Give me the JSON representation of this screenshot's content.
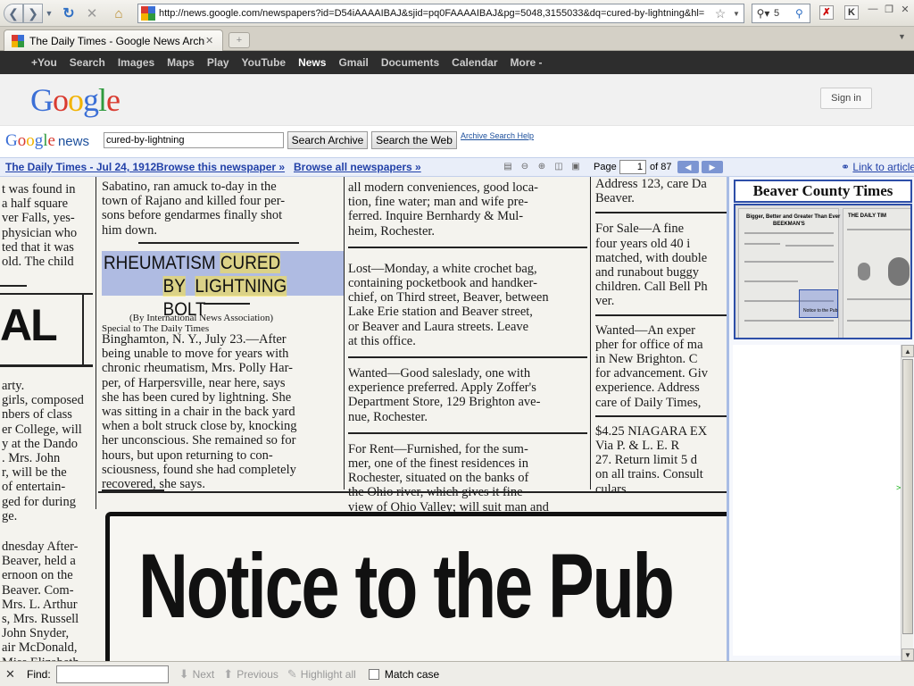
{
  "browser": {
    "url": "http://news.google.com/newspapers?id=D54iAAAAIBAJ&sjid=pq0FAAAAIBAJ&pg=5048,3155033&dq=cured-by-lightning&hl=",
    "search_value": "5",
    "tab_title": "The Daily Times - Google News Archi...",
    "icons": {
      "back": "back-arrow-icon",
      "forward": "forward-arrow-icon",
      "reload": "reload-icon",
      "stop": "stop-icon",
      "home": "home-icon",
      "bookmark": "star-icon",
      "search_engine": "magnifier-icon"
    }
  },
  "gbar": {
    "items": [
      "+You",
      "Search",
      "Images",
      "Maps",
      "Play",
      "YouTube",
      "News",
      "Gmail",
      "Documents",
      "Calendar",
      "More -"
    ],
    "active": "News"
  },
  "header": {
    "logo": "Google",
    "logo_colors": [
      "#3b6fd6",
      "#d93b30",
      "#f2b300",
      "#3b6fd6",
      "#2f9a3e",
      "#d93b30"
    ],
    "sign_in": "Sign in"
  },
  "search_row": {
    "logo": "Google",
    "logo_suffix": "news",
    "query": "cured-by-lightning",
    "search_archive": "Search Archive",
    "search_web": "Search the Web",
    "help": "Archive Search Help"
  },
  "info_bar": {
    "paper": "The Daily Times - Jul 24, 1912",
    "browse_this": "Browse this newspaper »",
    "browse_all": "Browse all newspapers »",
    "page_label": "Page",
    "page": "1",
    "page_total": "of 87",
    "link_article": "Link to article"
  },
  "article": {
    "headline_1": "RHEUMATISM CURED",
    "headline_2": "BY LIGHTNING BOLT",
    "byline_1": "(By International News Association)",
    "byline_2": "Special to The Daily Times",
    "col2_top": [
      "Sabatino, ran amuck to-day in the",
      "town of Rajano and killed four per-",
      "sons before gendarmes finally shot",
      "him down."
    ],
    "col2_body": [
      "Binghamton, N. Y., July 23.—After",
      "being unable to move for years with",
      "chronic rheumatism, Mrs. Polly Har-",
      "per, of Harpersville, near here, says",
      "she has been cured by lightning. She",
      "was sitting in a chair in the back yard",
      "when a bolt struck close by, knocking",
      "her unconscious. She remained so for",
      "hours, but upon returning to con-",
      "sciousness, found she had completely",
      "recovered, she says."
    ],
    "col1_top": [
      "t was found in",
      " a half square",
      "ver Falls, yes-",
      "physician who",
      "ted that it was",
      "old. The child"
    ],
    "col1_big": "AL",
    "col1_mid": [
      "arty.",
      "girls, composed",
      "nbers of class",
      "er College, will",
      "y at the Dando",
      ". Mrs. John",
      "r, will be the",
      "of entertain-",
      "ged for during",
      "ge."
    ],
    "col1_bottom": [
      "dnesday After-",
      "Beaver, held a",
      "ernoon on the",
      " Beaver. Com-",
      "Mrs. L. Arthur",
      "s, Mrs. Russell",
      " John Snyder,",
      "air McDonald,",
      "Miss Elizabeth"
    ],
    "col3_a": [
      "all modern conveniences, good loca-",
      "tion, fine water; man and wife pre-",
      "ferred. Inquire Bernhardy & Mul-",
      "heim, Rochester."
    ],
    "col3_b": [
      "Lost—Monday, a white crochet bag,",
      "containing pocketbook and handker-",
      "chief, on Third street, Beaver, between",
      "Lake Erie station and Beaver street,",
      "or Beaver and Laura streets. Leave",
      "at this office."
    ],
    "col3_c": [
      "Wanted—Good saleslady, one with",
      "experience preferred. Apply Zoffer's",
      "Department Store, 129 Brighton ave-",
      "nue, Rochester."
    ],
    "col3_d": [
      "For Rent—Furnished, for the sum-",
      "mer, one of the finest residences in",
      "Rochester, situated on the banks of",
      "the Ohio river, which gives it fine",
      "view of Ohio Valley; will suit man and"
    ],
    "col4_a": [
      "Address 123, care Da",
      "Beaver."
    ],
    "col4_b": [
      "For Sale—A fine",
      "four years old 40 i",
      "matched, with double",
      "and runabout buggy",
      "children. Call Bell Ph",
      "ver."
    ],
    "col4_c": [
      "Wanted—An exper",
      "pher for office of ma",
      "in New Brighton. C",
      "for advancement. Giv",
      "experience. Address",
      "care of Daily Times,"
    ],
    "col4_d": [
      "$4.25 NIAGARA EX",
      "Via P. & L. E. R",
      "27. Return limit 5 d",
      "on all trains. Consult",
      "culars."
    ],
    "ad_headline": "Notice to the Pub"
  },
  "sidebar": {
    "masthead": "Beaver County Times",
    "thumb_a_head": "Bigger, Better and Greater Than Ever",
    "thumb_a_sub": "BEEKMAN'S",
    "thumb_b_head": "THE DAILY TIM",
    "thumb_notice": "Notice to the Pub"
  },
  "find_bar": {
    "label": "Find:",
    "next": "Next",
    "previous": "Previous",
    "highlight": "Highlight all",
    "match_case": "Match case"
  }
}
